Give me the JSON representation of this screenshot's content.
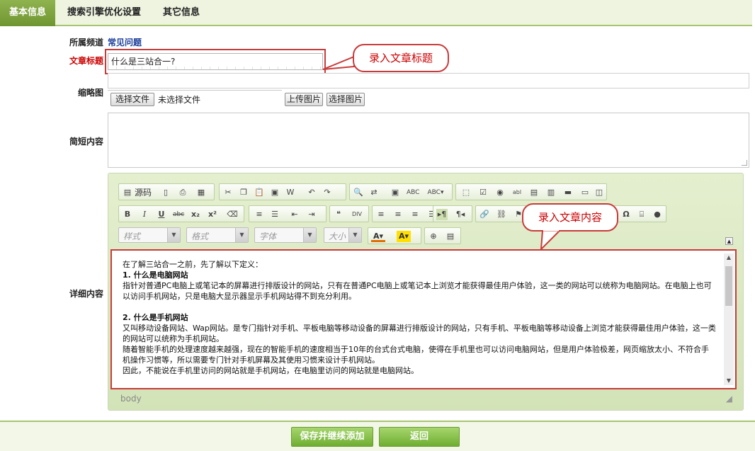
{
  "tabs": [
    {
      "label": "基本信息"
    },
    {
      "label": "搜索引擎优化设置"
    },
    {
      "label": "其它信息"
    }
  ],
  "form": {
    "channel_label": "所属频道",
    "channel_value": "常见问题",
    "title_label": "文章标题",
    "title_value": "什么是三站合一?",
    "thumb_label": "缩略图",
    "choose_file_label": "选择文件",
    "file_status": "未选择文件",
    "upload_image_label": "上传图片",
    "select_image_label": "选择图片",
    "summary_label": "简短内容",
    "detail_label": "详细内容"
  },
  "editor": {
    "source_label": "源码",
    "style_placeholder": "样式",
    "format_placeholder": "格式",
    "font_placeholder": "字体",
    "size_placeholder": "大小",
    "path_label": "body",
    "content": {
      "intro": "在了解三站合一之前，先了解以下定义：",
      "h1": "1. 什么是电脑网站",
      "p1": "指针对普通PC电脑上或笔记本的屏幕进行排版设计的网站，只有在普通PC电脑上或笔记本上浏览才能获得最佳用户体验，这一类的网站可以统称为电脑网站。在电脑上也可以访问手机网站，只是电脑大显示器显示手机网站得不到充分利用。",
      "h2": "2. 什么是手机网站",
      "p2": "又叫移动设备网站、Wap网站。是专门指针对手机、平板电脑等移动设备的屏幕进行排版设计的网站，只有手机、平板电脑等移动设备上浏览才能获得最佳用户体验，这一类的网站可以统称为手机网站。",
      "p3": "随着智能手机的处理速度越来越强，现在的智能手机的速度相当于10年的台式台式电脑，使得在手机里也可以访问电脑网站，但是用户体验极差，网页缩放太小、不符合手机操作习惯等，所以需要专门针对手机屏幕及其使用习惯来设计手机网站。",
      "p4": "因此，不能说在手机里访问的网站就是手机网站，在电脑里访问的网站就是电脑网站。"
    }
  },
  "callouts": {
    "title_note": "录入文章标题",
    "content_note": "录入文章内容"
  },
  "footer": {
    "save_label": "保存并继续添加",
    "back_label": "返回"
  },
  "colors": {
    "accent_green": "#7fa63f",
    "highlight_red": "#c83b3b",
    "channel_blue": "#1a3d9a"
  }
}
